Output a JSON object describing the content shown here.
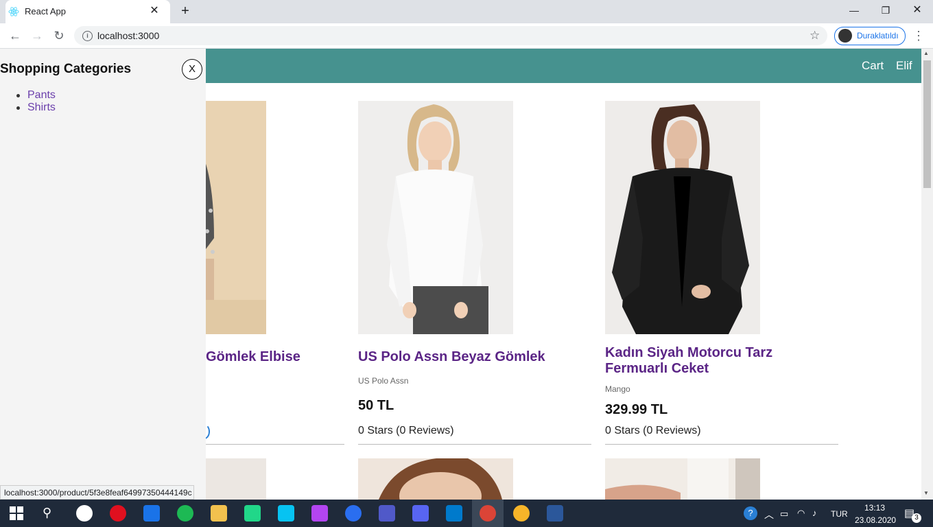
{
  "browser": {
    "tab_title": "React App",
    "url": "localhost:3000",
    "profile_label": "Duraklatıldı",
    "status_url": "localhost:3000/product/5f3e8feaf64997350444149c"
  },
  "header": {
    "cart_label": "Cart",
    "user_label": "Elif"
  },
  "sidebar": {
    "title": "Shopping Categories",
    "close_label": "X",
    "items": [
      {
        "label": "Pants"
      },
      {
        "label": "Shirts"
      }
    ]
  },
  "products": [
    {
      "title": "Gömlek Elbise"
    },
    {
      "title": "US Polo Assn Beyaz Gömlek",
      "brand": "US Polo Assn",
      "price": "50 TL",
      "rating": "0 Stars (0 Reviews)"
    },
    {
      "title": "Kadın Siyah Motorcu Tarz Fermuarlı Ceket",
      "brand": "Mango",
      "price": "329.99 TL",
      "rating": "0 Stars (0 Reviews)"
    }
  ],
  "taskbar": {
    "language": "TUR",
    "time": "13:13",
    "date": "23.08.2020",
    "notifications": "3"
  }
}
